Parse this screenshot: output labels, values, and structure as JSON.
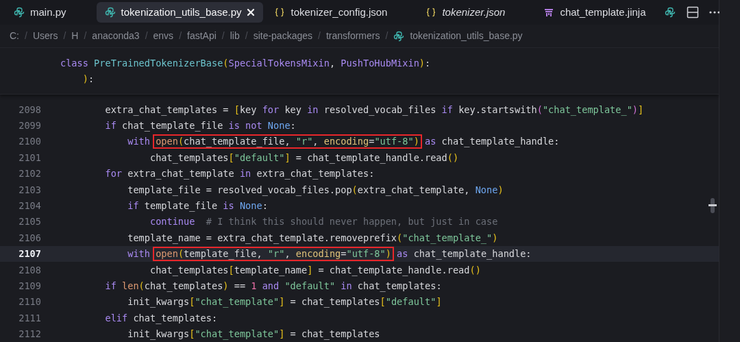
{
  "tabs": [
    {
      "label": "main.py",
      "kind": "python",
      "selected": false,
      "preview": false,
      "closable": false
    },
    {
      "label": "tokenization_utils_base.py",
      "kind": "python",
      "selected": true,
      "preview": false,
      "closable": true
    },
    {
      "label": "tokenizer_config.json",
      "kind": "json",
      "selected": false,
      "preview": false,
      "closable": false
    },
    {
      "label": "tokenizer.json",
      "kind": "json",
      "selected": false,
      "preview": true,
      "closable": false
    },
    {
      "label": "chat_template.jinja",
      "kind": "jinja",
      "selected": false,
      "preview": false,
      "closable": false
    },
    {
      "kind": "python",
      "selected": false
    }
  ],
  "breadcrumbs": {
    "separator": "/",
    "items": [
      {
        "label": "C:"
      },
      {
        "label": "Users"
      },
      {
        "label": "H"
      },
      {
        "label": "anaconda3"
      },
      {
        "label": "envs"
      },
      {
        "label": "fastApi"
      },
      {
        "label": "lib"
      },
      {
        "label": "site-packages"
      },
      {
        "label": "transformers"
      },
      {
        "label": "tokenization_utils_base.py",
        "kind": "python"
      }
    ]
  },
  "sticky_lines": [
    {
      "tokens": [
        {
          "kind": "kw",
          "text": "class "
        },
        {
          "kind": "cls",
          "text": "PreTrainedTokenizerBase"
        },
        {
          "kind": "bracket",
          "text": "("
        },
        {
          "kind": "base",
          "text": "SpecialTokensMixin"
        },
        {
          "kind": "plain",
          "text": ", "
        },
        {
          "kind": "base",
          "text": "PushToHubMixin"
        },
        {
          "kind": "bracket",
          "text": ")"
        },
        {
          "kind": "plain",
          "text": ":"
        }
      ]
    },
    {
      "tokens": [
        {
          "kind": "bracket",
          "text": "    )"
        },
        {
          "kind": "plain",
          "text": ":"
        }
      ]
    }
  ],
  "lines": [
    {
      "number": "2098",
      "current": false,
      "tokens": [
        {
          "kind": "plain",
          "text": "        extra_chat_templates = "
        },
        {
          "kind": "bracket",
          "text": "["
        },
        {
          "kind": "plain",
          "text": "key "
        },
        {
          "kind": "kw",
          "text": "for"
        },
        {
          "kind": "plain",
          "text": " key "
        },
        {
          "kind": "kw",
          "text": "in"
        },
        {
          "kind": "plain",
          "text": " resolved_vocab_files "
        },
        {
          "kind": "kw",
          "text": "if"
        },
        {
          "kind": "plain",
          "text": " key.startswith"
        },
        {
          "kind": "bracket2",
          "text": "("
        },
        {
          "kind": "str",
          "text": "\"chat_template_\""
        },
        {
          "kind": "bracket2",
          "text": ")"
        },
        {
          "kind": "bracket",
          "text": "]"
        }
      ]
    },
    {
      "number": "2099",
      "current": false,
      "tokens": [
        {
          "kind": "kw",
          "text": "        if"
        },
        {
          "kind": "plain",
          "text": " chat_template_file "
        },
        {
          "kind": "kw",
          "text": "is not "
        },
        {
          "kind": "const",
          "text": "None"
        },
        {
          "kind": "plain",
          "text": ":"
        }
      ]
    },
    {
      "number": "2100",
      "current": false,
      "tokens": [
        {
          "kind": "kw",
          "text": "            with "
        },
        {
          "kind": "box",
          "tokens": [
            {
              "kind": "fn",
              "text": "open"
            },
            {
              "kind": "bracket",
              "text": "("
            },
            {
              "kind": "plain",
              "text": "chat_template_file, "
            },
            {
              "kind": "str",
              "text": "\"r\""
            },
            {
              "kind": "plain",
              "text": ", "
            },
            {
              "kind": "param",
              "text": "encoding"
            },
            {
              "kind": "plain",
              "text": "="
            },
            {
              "kind": "str",
              "text": "\"utf-8\""
            },
            {
              "kind": "bracket",
              "text": ")"
            }
          ]
        },
        {
          "kind": "kw",
          "text": " as"
        },
        {
          "kind": "plain",
          "text": " chat_template_handle:"
        }
      ]
    },
    {
      "number": "2101",
      "current": false,
      "tokens": [
        {
          "kind": "plain",
          "text": "                chat_templates"
        },
        {
          "kind": "bracket",
          "text": "["
        },
        {
          "kind": "str",
          "text": "\"default\""
        },
        {
          "kind": "bracket",
          "text": "]"
        },
        {
          "kind": "plain",
          "text": " = chat_template_handle.read"
        },
        {
          "kind": "bracket",
          "text": "()"
        }
      ]
    },
    {
      "number": "2102",
      "current": false,
      "tokens": [
        {
          "kind": "kw",
          "text": "        for"
        },
        {
          "kind": "plain",
          "text": " extra_chat_template "
        },
        {
          "kind": "kw",
          "text": "in"
        },
        {
          "kind": "plain",
          "text": " extra_chat_templates:"
        }
      ]
    },
    {
      "number": "2103",
      "current": false,
      "tokens": [
        {
          "kind": "plain",
          "text": "            template_file = resolved_vocab_files.pop"
        },
        {
          "kind": "bracket",
          "text": "("
        },
        {
          "kind": "plain",
          "text": "extra_chat_template, "
        },
        {
          "kind": "const",
          "text": "None"
        },
        {
          "kind": "bracket",
          "text": ")"
        }
      ]
    },
    {
      "number": "2104",
      "current": false,
      "tokens": [
        {
          "kind": "kw",
          "text": "            if"
        },
        {
          "kind": "plain",
          "text": " template_file "
        },
        {
          "kind": "kw",
          "text": "is "
        },
        {
          "kind": "const",
          "text": "None"
        },
        {
          "kind": "plain",
          "text": ":"
        }
      ]
    },
    {
      "number": "2105",
      "current": false,
      "tokens": [
        {
          "kind": "kw",
          "text": "                continue"
        },
        {
          "kind": "comment",
          "text": "  # I think this should never happen, but just in case"
        }
      ]
    },
    {
      "number": "2106",
      "current": false,
      "tokens": [
        {
          "kind": "plain",
          "text": "            template_name = extra_chat_template.removeprefix"
        },
        {
          "kind": "bracket",
          "text": "("
        },
        {
          "kind": "str",
          "text": "\"chat_template_\""
        },
        {
          "kind": "bracket",
          "text": ")"
        }
      ]
    },
    {
      "number": "2107",
      "current": true,
      "tokens": [
        {
          "kind": "kw",
          "text": "            with "
        },
        {
          "kind": "box",
          "tokens": [
            {
              "kind": "fn",
              "text": "open"
            },
            {
              "kind": "bracket",
              "text": "("
            },
            {
              "kind": "plain",
              "text": "template_file, "
            },
            {
              "kind": "str",
              "text": "\"r\""
            },
            {
              "kind": "plain",
              "text": ", "
            },
            {
              "kind": "param",
              "text": "encoding"
            },
            {
              "kind": "plain",
              "text": "="
            },
            {
              "kind": "str",
              "text": "\"utf-8\""
            },
            {
              "kind": "bracket",
              "text": ")"
            }
          ]
        },
        {
          "kind": "kw",
          "text": " as"
        },
        {
          "kind": "plain",
          "text": " chat_template_handle:"
        }
      ]
    },
    {
      "number": "2108",
      "current": false,
      "tokens": [
        {
          "kind": "plain",
          "text": "                chat_templates"
        },
        {
          "kind": "bracket",
          "text": "["
        },
        {
          "kind": "plain",
          "text": "template_name"
        },
        {
          "kind": "bracket",
          "text": "]"
        },
        {
          "kind": "plain",
          "text": " = chat_template_handle.read"
        },
        {
          "kind": "bracket",
          "text": "()"
        }
      ]
    },
    {
      "number": "2109",
      "current": false,
      "tokens": [
        {
          "kind": "kw",
          "text": "        if "
        },
        {
          "kind": "fn",
          "text": "len"
        },
        {
          "kind": "bracket",
          "text": "("
        },
        {
          "kind": "plain",
          "text": "chat_templates"
        },
        {
          "kind": "bracket",
          "text": ")"
        },
        {
          "kind": "plain",
          "text": " == "
        },
        {
          "kind": "num",
          "text": "1"
        },
        {
          "kind": "kw",
          "text": " and"
        },
        {
          "kind": "str",
          "text": " \"default\""
        },
        {
          "kind": "kw",
          "text": " in"
        },
        {
          "kind": "plain",
          "text": " chat_templates:"
        }
      ]
    },
    {
      "number": "2110",
      "current": false,
      "tokens": [
        {
          "kind": "plain",
          "text": "            init_kwargs"
        },
        {
          "kind": "bracket",
          "text": "["
        },
        {
          "kind": "str",
          "text": "\"chat_template\""
        },
        {
          "kind": "bracket",
          "text": "]"
        },
        {
          "kind": "plain",
          "text": " = chat_templates"
        },
        {
          "kind": "bracket",
          "text": "["
        },
        {
          "kind": "str",
          "text": "\"default\""
        },
        {
          "kind": "bracket",
          "text": "]"
        }
      ]
    },
    {
      "number": "2111",
      "current": false,
      "tokens": [
        {
          "kind": "kw",
          "text": "        elif"
        },
        {
          "kind": "plain",
          "text": " chat_templates:"
        }
      ]
    },
    {
      "number": "2112",
      "current": false,
      "tokens": [
        {
          "kind": "plain",
          "text": "            init_kwargs"
        },
        {
          "kind": "bracket",
          "text": "["
        },
        {
          "kind": "str",
          "text": "\"chat_template\""
        },
        {
          "kind": "bracket",
          "text": "]"
        },
        {
          "kind": "plain",
          "text": " = chat_templates"
        }
      ]
    }
  ]
}
